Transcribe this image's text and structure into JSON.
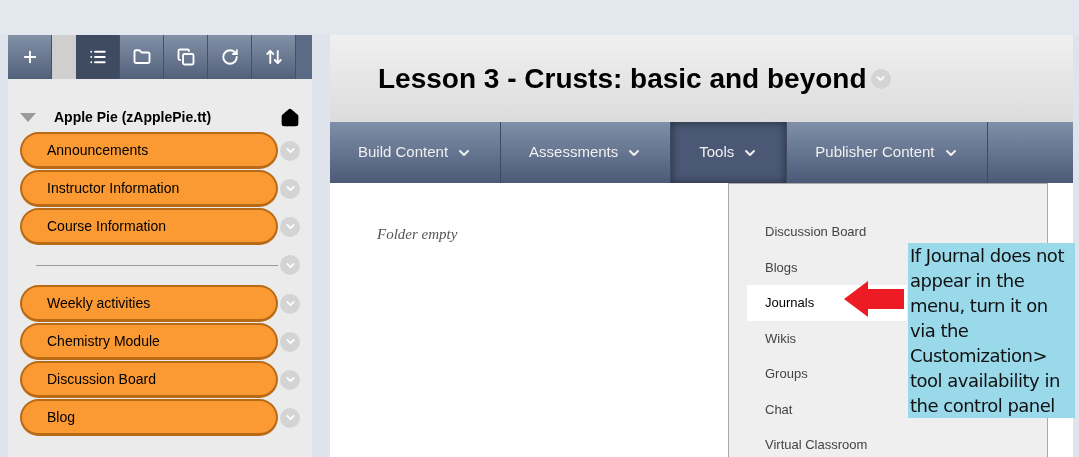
{
  "toolbar": [
    {
      "selected": false
    },
    {
      "selected": true
    },
    {
      "selected": false
    },
    {
      "selected": false
    },
    {
      "selected": false
    },
    {
      "selected": false
    }
  ],
  "course": {
    "title": "Apple Pie (zApplePie.tt)",
    "expanded": true
  },
  "menu": [
    {
      "kind": "item",
      "label": "Announcements"
    },
    {
      "kind": "item",
      "label": "Instructor Information"
    },
    {
      "kind": "item",
      "label": "Course Information"
    },
    {
      "kind": "divider"
    },
    {
      "kind": "item",
      "label": "Weekly activities"
    },
    {
      "kind": "item",
      "label": "Chemistry Module"
    },
    {
      "kind": "item",
      "label": "Discussion Board"
    },
    {
      "kind": "item",
      "label": "Blog"
    }
  ],
  "page_title": "Lesson 3 - Crusts: basic and beyond",
  "nav": [
    {
      "label": "Build Content",
      "selected": false
    },
    {
      "label": "Assessments",
      "selected": false
    },
    {
      "label": "Tools",
      "selected": true
    },
    {
      "label": "Publisher Content",
      "selected": false
    }
  ],
  "content": {
    "empty_message": "Folder empty"
  },
  "tools_menu": [
    {
      "label": "Discussion Board",
      "selected": false
    },
    {
      "label": "Blogs",
      "selected": false
    },
    {
      "label": "Journals",
      "selected": true
    },
    {
      "label": "Wikis",
      "selected": false
    },
    {
      "label": "Groups",
      "selected": false
    },
    {
      "label": "Chat",
      "selected": false
    },
    {
      "label": "Virtual Classroom",
      "selected": false
    }
  ],
  "callout": {
    "text": "If Journal does not appear in the menu, turn it on via the Customization> tool availability in the control panel"
  }
}
